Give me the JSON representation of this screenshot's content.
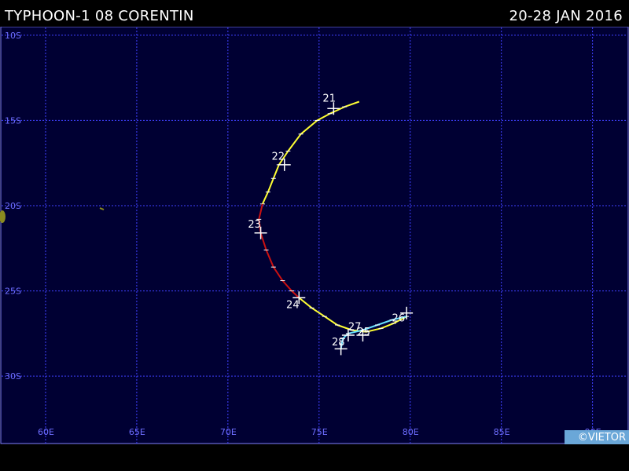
{
  "header": {
    "title": "TYPHOON-1 08 CORENTIN",
    "date_range": "20-28 JAN 2016"
  },
  "map": {
    "lon_range": [
      57.5,
      92.0
    ],
    "lat_range": [
      -9.5,
      -34.0
    ],
    "lat_labels": [
      "10S",
      "15S",
      "20S",
      "25S",
      "30S"
    ],
    "lat_values": [
      -10,
      -15,
      -20,
      -25,
      -30
    ],
    "lon_labels": [
      "60E",
      "65E",
      "70E",
      "75E",
      "80E",
      "85E",
      "90E"
    ],
    "lon_values": [
      60,
      65,
      70,
      75,
      80,
      85,
      90
    ],
    "colors": {
      "ocean": "#000033",
      "grid": "#4040ff",
      "label": "#6d6dff",
      "track_yellow": "#ffff33",
      "track_red": "#cc1111",
      "track_cyan": "#66e0ff",
      "land": "#8a8a20"
    }
  },
  "track": {
    "segments": [
      {
        "color": "track_yellow",
        "points": [
          [
            77.2,
            -13.9
          ],
          [
            76.4,
            -14.2
          ],
          [
            75.6,
            -14.6
          ],
          [
            74.9,
            -15.0
          ],
          [
            74.0,
            -15.8
          ],
          [
            73.3,
            -16.8
          ],
          [
            72.8,
            -17.6
          ],
          [
            72.5,
            -18.4
          ],
          [
            72.2,
            -19.2
          ],
          [
            71.9,
            -19.9
          ]
        ]
      },
      {
        "color": "track_red",
        "points": [
          [
            71.9,
            -19.9
          ],
          [
            71.7,
            -20.8
          ],
          [
            71.8,
            -21.6
          ],
          [
            72.1,
            -22.6
          ],
          [
            72.5,
            -23.6
          ],
          [
            73.0,
            -24.4
          ],
          [
            73.5,
            -25.0
          ],
          [
            73.9,
            -25.4
          ]
        ]
      },
      {
        "color": "track_yellow",
        "points": [
          [
            73.9,
            -25.4
          ],
          [
            74.6,
            -26.0
          ],
          [
            75.3,
            -26.5
          ],
          [
            76.0,
            -27.0
          ],
          [
            76.8,
            -27.3
          ],
          [
            77.6,
            -27.4
          ],
          [
            78.4,
            -27.2
          ],
          [
            79.1,
            -26.9
          ],
          [
            79.8,
            -26.5
          ]
        ]
      },
      {
        "color": "track_cyan",
        "points": [
          [
            79.8,
            -26.5
          ],
          [
            79.0,
            -26.7
          ],
          [
            78.2,
            -27.0
          ],
          [
            77.4,
            -27.3
          ],
          [
            76.6,
            -27.5
          ],
          [
            76.3,
            -27.8
          ],
          [
            76.2,
            -28.4
          ]
        ]
      }
    ],
    "day_labels": [
      {
        "text": "21",
        "lon": 75.2,
        "lat": -13.9
      },
      {
        "text": "22",
        "lon": 72.4,
        "lat": -17.3
      },
      {
        "text": "23",
        "lon": 71.1,
        "lat": -21.3
      },
      {
        "text": "24",
        "lon": 73.2,
        "lat": -26.0
      },
      {
        "text": "27",
        "lon": 76.6,
        "lat": -27.3
      },
      {
        "text": "25",
        "lon": 77.1,
        "lat": -27.6
      },
      {
        "text": "28",
        "lon": 75.7,
        "lat": -28.2
      },
      {
        "text": "26",
        "lon": 79.0,
        "lat": -26.8
      }
    ],
    "cross_points": [
      [
        75.8,
        -14.3
      ],
      [
        73.1,
        -17.6
      ],
      [
        71.8,
        -21.6
      ],
      [
        73.9,
        -25.4
      ],
      [
        76.6,
        -27.6
      ],
      [
        77.4,
        -27.6
      ],
      [
        76.2,
        -28.4
      ],
      [
        79.8,
        -26.3
      ]
    ]
  },
  "credit": "©VIETOR"
}
